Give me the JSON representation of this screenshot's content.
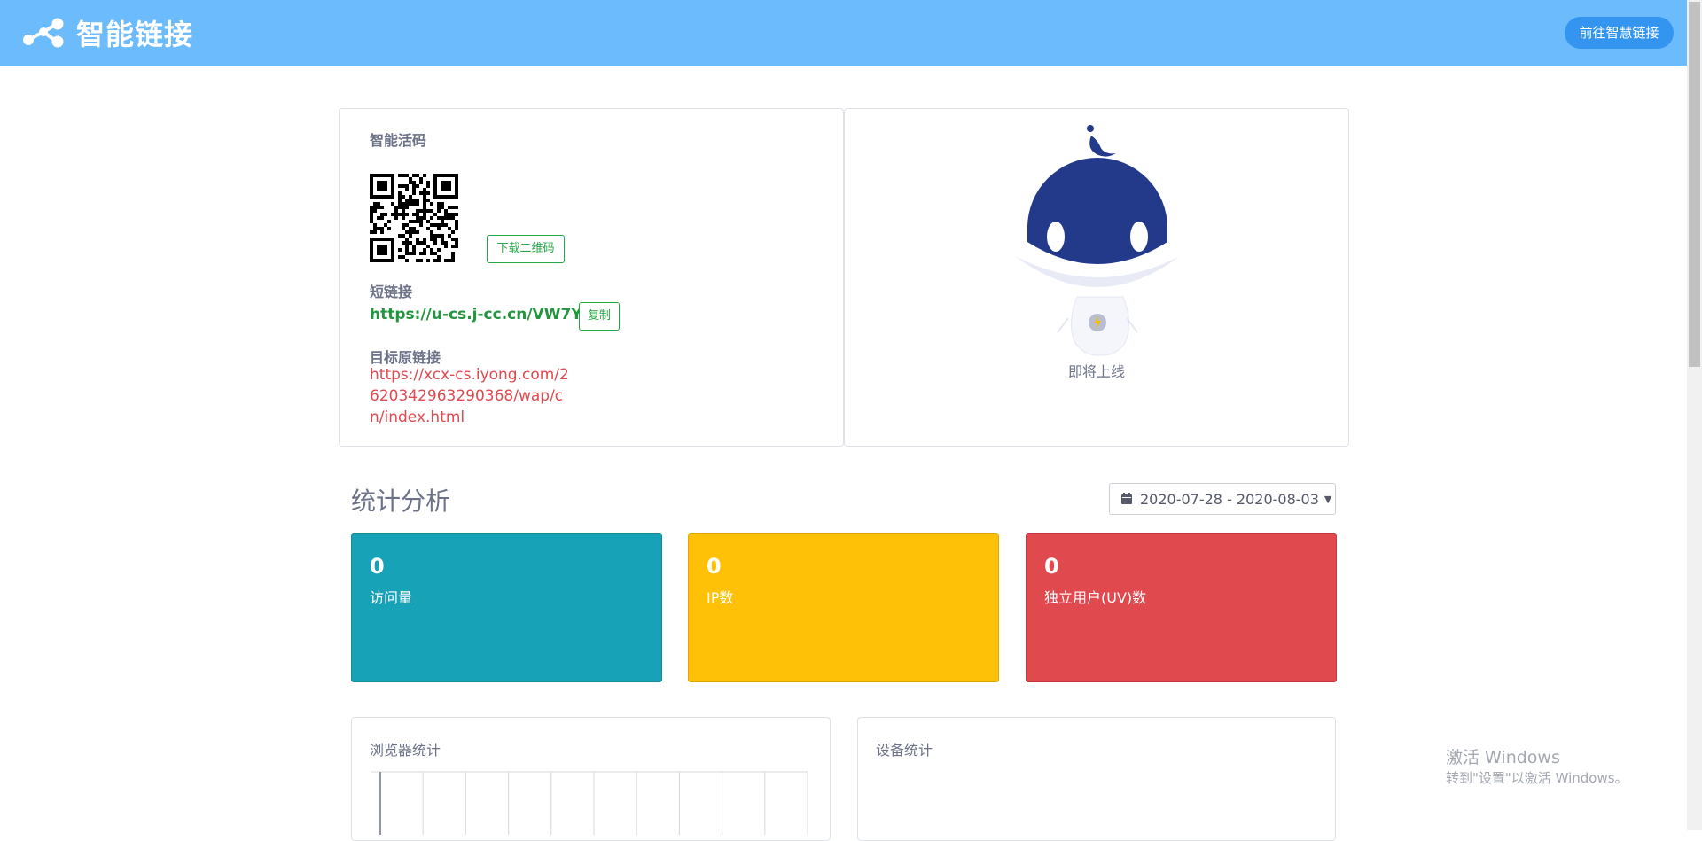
{
  "header": {
    "title": "智能链接",
    "goto_button": "前往智慧链接"
  },
  "link_card": {
    "qr_title": "智能活码",
    "download_button": "下载二维码",
    "short_link_title": "短链接",
    "short_link": "https://u-cs.j-cc.cn/VW7Ywy",
    "copy_button": "复制",
    "target_title": "目标原链接",
    "target_link": "https://xcx-cs.iyong.com/2620342963290368/wap/cn/index.html"
  },
  "robot_card": {
    "status": "即将上线"
  },
  "stats": {
    "title": "统计分析",
    "date_range": "2020-07-28 - 2020-08-03",
    "boxes": [
      {
        "value": "0",
        "label": "访问量"
      },
      {
        "value": "0",
        "label": "IP数"
      },
      {
        "value": "0",
        "label": "独立用户(UV)数"
      }
    ],
    "browser_title": "浏览器统计",
    "device_title": "设备统计"
  },
  "watermark": {
    "title": "激活 Windows",
    "subtitle": "转到\"设置\"以激活 Windows。"
  },
  "colors": {
    "header": "#6cbbfd",
    "goto_button": "#3495f0",
    "visits": "#17a2b8",
    "ip": "#ffc107",
    "uv": "#e04a4f",
    "short_link": "#23953f",
    "target_link": "#e04a4f"
  },
  "icons": [
    "share-nodes-icon",
    "calendar-icon",
    "caret-down-icon"
  ]
}
